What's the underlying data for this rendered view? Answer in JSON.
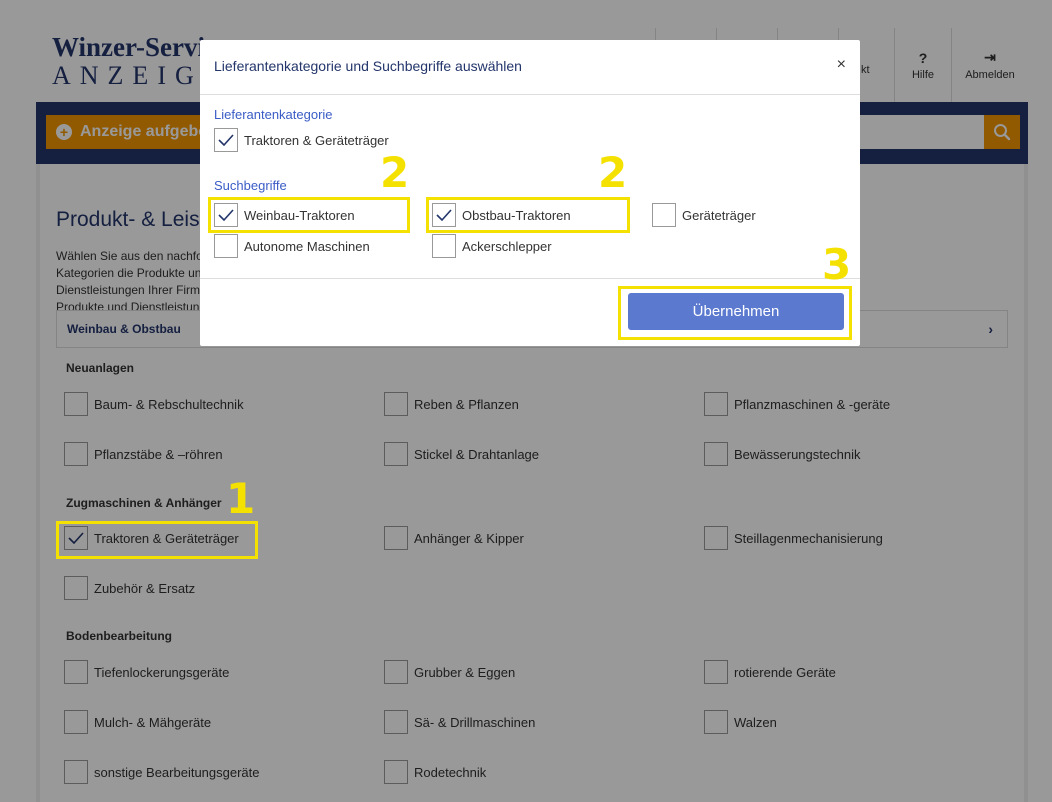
{
  "header": {
    "logo_top": "Winzer-Service",
    "logo_bottom": "ANZEIGEN",
    "nav": [
      {
        "label": "kt"
      },
      {
        "label": "Hilfe",
        "icon": "?"
      },
      {
        "label": "Abmelden",
        "icon": "⇥"
      }
    ]
  },
  "toolbar": {
    "add_button": "Anzeige aufgeben"
  },
  "main": {
    "title": "Produkt- & Leistungsangebote",
    "description": "Wählen Sie aus den nachfolgenden Kategorien die Produkte und Dienstleistungen Ihrer Firma Produkte und Dienstleistungen aus",
    "category_tab": "Weinbau & Obstbau",
    "sections": [
      {
        "heading": "Neuanlagen",
        "items": [
          "Baum- & Rebschultechnik",
          "Reben & Pflanzen",
          "Pflanzmaschinen & -geräte",
          "Pflanzstäbe & –röhren",
          "Stickel & Drahtanlage",
          "Bewässerungstechnik"
        ]
      },
      {
        "heading": "Zugmaschinen & Anhänger",
        "items": [
          "Traktoren & Geräteträger",
          "Anhänger & Kipper",
          "Steillagenmechanisierung",
          "Zubehör & Ersatz"
        ]
      },
      {
        "heading": "Bodenbearbeitung",
        "items": [
          "Tiefenlockerungsgeräte",
          "Grubber & Eggen",
          "rotierende Geräte",
          "Mulch- & Mähgeräte",
          "Sä- & Drillmaschinen",
          "Walzen",
          "sonstige Bearbeitungsgeräte",
          "Rodetechnik"
        ]
      }
    ],
    "checked": [
      "Traktoren & Geräteträger"
    ]
  },
  "modal": {
    "title": "Lieferantenkategorie und Suchbegriffe auswählen",
    "close": "×",
    "category_heading": "Lieferantenkategorie",
    "category_item": "Traktoren & Geräteträger",
    "terms_heading": "Suchbegriffe",
    "terms": [
      {
        "label": "Weinbau-Traktoren",
        "checked": true
      },
      {
        "label": "Obstbau-Traktoren",
        "checked": true
      },
      {
        "label": "Geräteträger",
        "checked": false
      },
      {
        "label": "Autonome Maschinen",
        "checked": false
      },
      {
        "label": "Ackerschlepper",
        "checked": false
      }
    ],
    "apply_button": "Übernehmen"
  },
  "annotations": [
    "1",
    "2",
    "2",
    "3"
  ],
  "colors": {
    "brand_blue": "#23356b",
    "accent_orange": "#f29400",
    "highlight_yellow": "#f5e100",
    "button_blue": "#5a79cf"
  }
}
